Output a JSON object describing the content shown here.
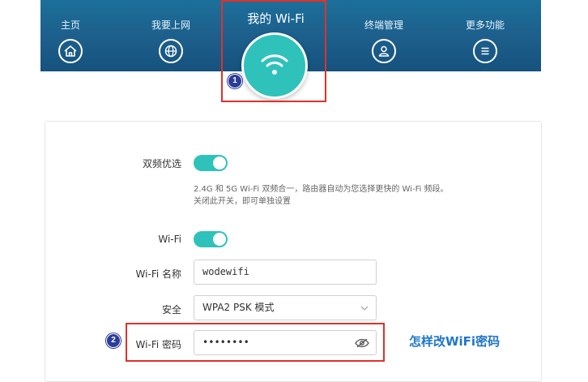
{
  "nav": {
    "home": {
      "label": "主页",
      "icon": "home-icon"
    },
    "internet": {
      "label": "我要上网",
      "icon": "globe-icon"
    },
    "wifi": {
      "label": "我的 Wi-Fi",
      "icon": "wifi-icon",
      "active": true
    },
    "terminal": {
      "label": "终端管理",
      "icon": "user-icon"
    },
    "more": {
      "label": "更多功能",
      "icon": "menu-icon"
    }
  },
  "annotations": {
    "marker1": "1",
    "marker2": "2",
    "caption": "怎样改WiFi密码"
  },
  "settings": {
    "dual_band": {
      "label": "双频优选",
      "enabled": true,
      "description": "2.4G 和 5G Wi-Fi 双频合一，路由器自动为您选择更快的 Wi-Fi 频段。关闭此开关，即可单独设置"
    },
    "wifi": {
      "label": "Wi-Fi",
      "enabled": true
    },
    "wifi_name": {
      "label": "Wi-Fi 名称",
      "value": "wodewifi"
    },
    "security": {
      "label": "安全",
      "value": "WPA2 PSK 模式"
    },
    "password": {
      "label": "Wi-Fi 密码",
      "value": "••••••••"
    }
  },
  "colors": {
    "accent": "#2ec2bb",
    "nav_bg": "#1d5e8b",
    "highlight": "#e0312a"
  }
}
